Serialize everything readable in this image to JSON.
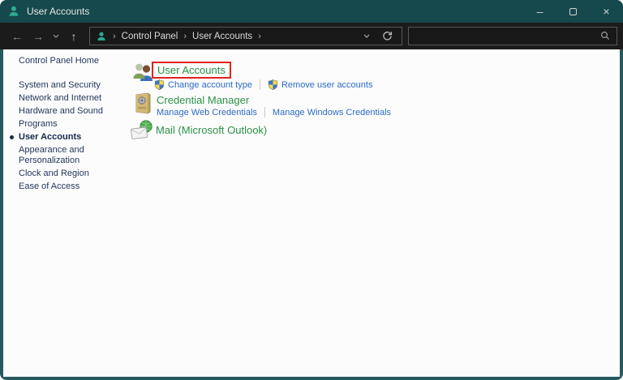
{
  "window": {
    "title": "User Accounts"
  },
  "icons": {
    "back": "←",
    "forward": "→",
    "up": "↑",
    "minimize": "–",
    "close": "×",
    "crumb_chevron": "›"
  },
  "navbar": {
    "breadcrumbs": [
      "Control Panel",
      "User Accounts"
    ],
    "search_value": ""
  },
  "sidebar": {
    "items": [
      {
        "label": "Control Panel Home",
        "active": false
      },
      {
        "label": "System and Security",
        "active": false
      },
      {
        "label": "Network and Internet",
        "active": false
      },
      {
        "label": "Hardware and Sound",
        "active": false
      },
      {
        "label": "Programs",
        "active": false
      },
      {
        "label": "User Accounts",
        "active": true
      },
      {
        "label": "Appearance and Personalization",
        "active": false
      },
      {
        "label": "Clock and Region",
        "active": false
      },
      {
        "label": "Ease of Access",
        "active": false
      }
    ]
  },
  "main": {
    "sections": [
      {
        "title": "User Accounts",
        "highlighted": true,
        "tasks": [
          {
            "label": "Change account type",
            "shield": true
          },
          {
            "label": "Remove user accounts",
            "shield": true
          }
        ]
      },
      {
        "title": "Credential Manager",
        "highlighted": false,
        "tasks": [
          {
            "label": "Manage Web Credentials",
            "shield": false
          },
          {
            "label": "Manage Windows Credentials",
            "shield": false
          }
        ]
      },
      {
        "title": "Mail (Microsoft Outlook)",
        "highlighted": false,
        "tasks": []
      }
    ]
  },
  "colors": {
    "titlebar_teal": "#15494d",
    "icon_teal": "#2eaa8f",
    "navbar_dark": "#1b1b1b",
    "heading_green": "#2c9146",
    "link_blue": "#2b6cc4",
    "sidebar_navy": "#25375e",
    "highlight_red": "#e0241b"
  }
}
